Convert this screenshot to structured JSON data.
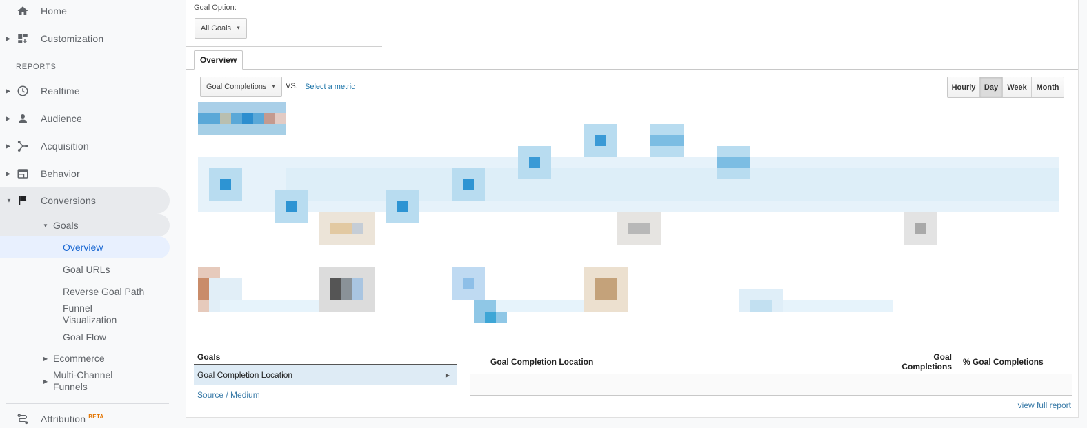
{
  "sidebar": {
    "items": [
      {
        "label": "Home",
        "icon": "home-icon"
      },
      {
        "label": "Customization",
        "icon": "dashboard-icon"
      }
    ],
    "section_label": "REPORTS",
    "reports": [
      {
        "label": "Realtime",
        "icon": "clock-icon"
      },
      {
        "label": "Audience",
        "icon": "person-icon"
      },
      {
        "label": "Acquisition",
        "icon": "acquisition-icon"
      },
      {
        "label": "Behavior",
        "icon": "behavior-icon"
      },
      {
        "label": "Conversions",
        "icon": "flag-icon"
      }
    ],
    "conversions_children": {
      "goals": {
        "label": "Goals",
        "children": [
          "Overview",
          "Goal URLs",
          "Reverse Goal Path",
          "Funnel Visualization",
          "Goal Flow"
        ]
      },
      "ecommerce": "Ecommerce",
      "multi_channel": "Multi-Channel Funnels"
    },
    "attribution": {
      "label": "Attribution",
      "badge": "BETA"
    }
  },
  "main": {
    "goal_option_label": "Goal Option:",
    "goal_option_value": "All Goals",
    "tab": "Overview",
    "metric_select": "Goal Completions",
    "vs_label": "VS.",
    "select_metric_link": "Select a metric",
    "periods": [
      "Hourly",
      "Day",
      "Week",
      "Month"
    ],
    "active_period": "Day",
    "chart_note": "chart area pixelated/redacted in screenshot",
    "goals_panel": {
      "heading": "Goals",
      "selected_item": "Goal Completion Location",
      "link_item": "Source / Medium"
    },
    "table": {
      "columns": [
        "Goal Completion Location",
        "Goal Completions",
        "% Goal Completions"
      ],
      "rows": [],
      "view_full_report": "view full report"
    }
  },
  "colors": {
    "sidebar_bg": "#f8f9fa",
    "active_item_bg": "#e8f0fe",
    "active_item_text": "#1967d2",
    "link": "#3a7ba8",
    "beta": "#e37400",
    "selected_row_bg": "#deebf5"
  }
}
